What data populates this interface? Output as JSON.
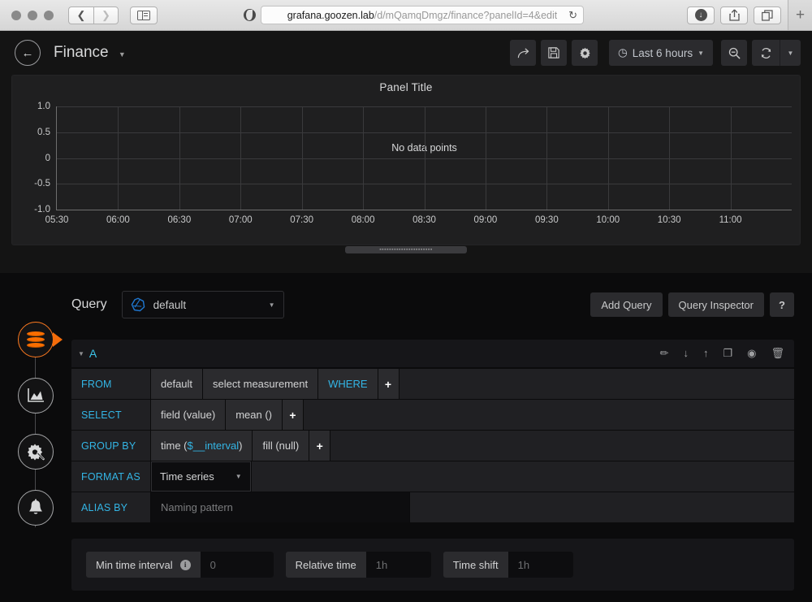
{
  "browser": {
    "url_host": "grafana.goozen.lab",
    "url_path": "/d/mQamqDmgz/finance?panelId=4&edit",
    "back_icon": "chevron-left-icon",
    "forward_icon": "chevron-right-icon",
    "reload_glyph": "↻",
    "download_glyph": "↓",
    "share_glyph": "↑",
    "tabs_glyph": "❐",
    "new_tab_glyph": "+"
  },
  "header": {
    "back_label": "←",
    "title": "Finance",
    "caret": "▼",
    "share_icon": "share-icon",
    "save_icon": "save-icon",
    "settings_icon": "gear-icon",
    "time_clock": "◷",
    "time_range": "Last 6 hours",
    "time_caret": "▼",
    "zoom_out_icon": "zoom-out-icon",
    "refresh_icon": "↻",
    "refresh_caret": "▼"
  },
  "panel": {
    "title": "Panel Title",
    "no_data": "No data points"
  },
  "chart_data": {
    "type": "line",
    "title": "Panel Title",
    "xlabel": "",
    "ylabel": "",
    "series": [],
    "x": [
      "05:30",
      "06:00",
      "06:30",
      "07:00",
      "07:30",
      "08:00",
      "08:30",
      "09:00",
      "09:30",
      "10:00",
      "10:30",
      "11:00"
    ],
    "yticks": [
      "1.0",
      "0.5",
      "0",
      "-0.5",
      "-1.0"
    ],
    "ylim": [
      -1.0,
      1.0
    ],
    "grid": true,
    "legend": "none",
    "annotation": "No data points"
  },
  "sidebar": {
    "items": [
      {
        "name": "queries-tab",
        "icon": "database-icon",
        "active": true
      },
      {
        "name": "visualization-tab",
        "icon": "graph-icon",
        "active": false
      },
      {
        "name": "general-tab",
        "icon": "gear-wrench-icon",
        "active": false
      },
      {
        "name": "alert-tab",
        "icon": "bell-icon",
        "active": false
      }
    ]
  },
  "query_section": {
    "label": "Query",
    "datasource": "default",
    "datasource_icon": "influxdb-icon",
    "datasource_caret": "▼",
    "add_query": "Add Query",
    "query_inspector": "Query Inspector",
    "help": "?"
  },
  "query_row": {
    "collapse_caret": "▼",
    "letter": "A",
    "actions": [
      {
        "name": "edit-query-icon",
        "glyph": "✏"
      },
      {
        "name": "move-down-icon",
        "glyph": "↓"
      },
      {
        "name": "move-up-icon",
        "glyph": "↑"
      },
      {
        "name": "duplicate-query-icon",
        "glyph": "❐"
      },
      {
        "name": "toggle-visibility-icon",
        "glyph": "◉"
      },
      {
        "name": "delete-query-icon",
        "glyph": "🗑"
      }
    ],
    "rows": {
      "from": {
        "key": "FROM",
        "policy": "default",
        "measurement": "select measurement",
        "where": "WHERE",
        "plus": "+"
      },
      "select": {
        "key": "SELECT",
        "field": "field (value)",
        "func": "mean ()",
        "plus": "+"
      },
      "group_by": {
        "key": "GROUP BY",
        "time_prefix": "time (",
        "time_var": "$__interval",
        "time_suffix": ")",
        "fill": "fill (null)",
        "plus": "+"
      },
      "format_as": {
        "key": "FORMAT AS",
        "value": "Time series",
        "caret": "▼"
      },
      "alias_by": {
        "key": "ALIAS BY",
        "placeholder": "Naming pattern",
        "value": ""
      }
    }
  },
  "options": {
    "min_time_interval_label": "Min time interval",
    "min_time_interval_info": "i",
    "min_time_interval_value": "0",
    "relative_time_label": "Relative time",
    "relative_time_value": "1h",
    "time_shift_label": "Time shift",
    "time_shift_value": "1h"
  },
  "colors": {
    "accent_blue": "#33b5e5",
    "accent_orange": "#ff7a1f",
    "panel_bg": "#1f1f20",
    "app_bg": "#141414"
  }
}
